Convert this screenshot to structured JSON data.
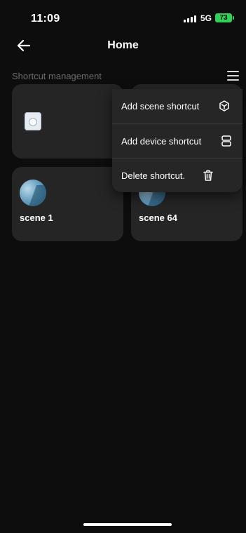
{
  "status": {
    "time": "11:09",
    "network": "5G",
    "battery": "73"
  },
  "nav": {
    "title": "Home"
  },
  "section": {
    "label": "Shortcut management"
  },
  "cards": [
    {
      "name": "scene 1"
    },
    {
      "name": "scene 64"
    }
  ],
  "menu": {
    "items": [
      {
        "label": "Add scene shortcut",
        "icon": "cube-icon"
      },
      {
        "label": "Add device shortcut",
        "icon": "device-icon"
      },
      {
        "label": "Delete shortcut.",
        "icon": "trash-icon"
      }
    ]
  },
  "colors": {
    "background": "#0d0d0d",
    "card": "#252525",
    "battery": "#2fd158"
  }
}
